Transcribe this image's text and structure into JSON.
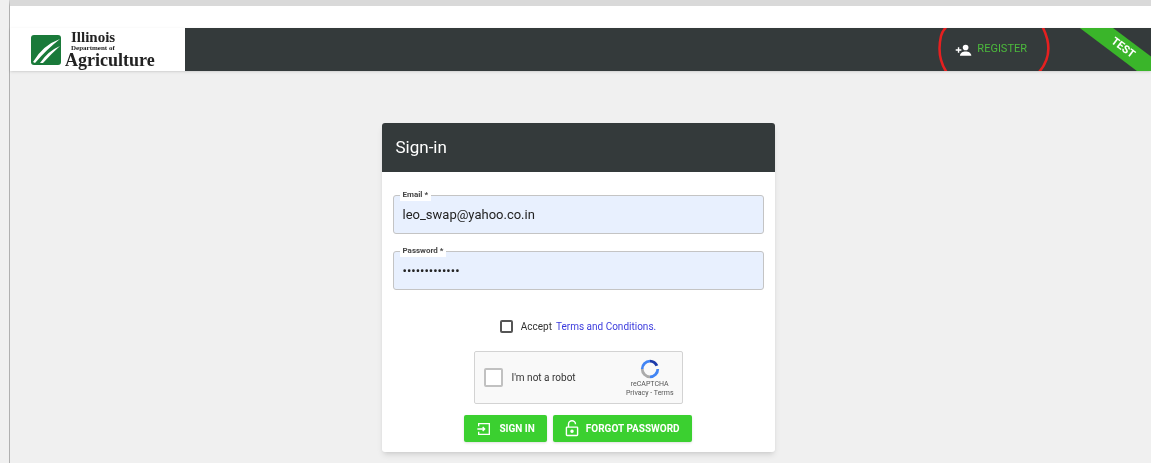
{
  "logo": {
    "line1": "Illinois",
    "line2": "Department of",
    "line3": "Agriculture"
  },
  "nav": {
    "register": "REGISTER",
    "ribbon": "TEST"
  },
  "card": {
    "title": "Sign-in",
    "email": {
      "label": "Email *",
      "value": "leo_swap@yahoo.co.in"
    },
    "password": {
      "label": "Password *",
      "value": "•••••••••••••"
    },
    "terms": {
      "checked": false,
      "text": "Accept",
      "link": "Terms and Conditions."
    },
    "captcha": {
      "checked": false,
      "label": "I'm not a robot",
      "brand": "reCAPTCHA",
      "links": "Privacy - Terms"
    },
    "buttons": [
      {
        "kind": "signin",
        "label": "SIGN IN"
      },
      {
        "kind": "forgot",
        "label": "FORGOT PASSWORD"
      }
    ]
  }
}
